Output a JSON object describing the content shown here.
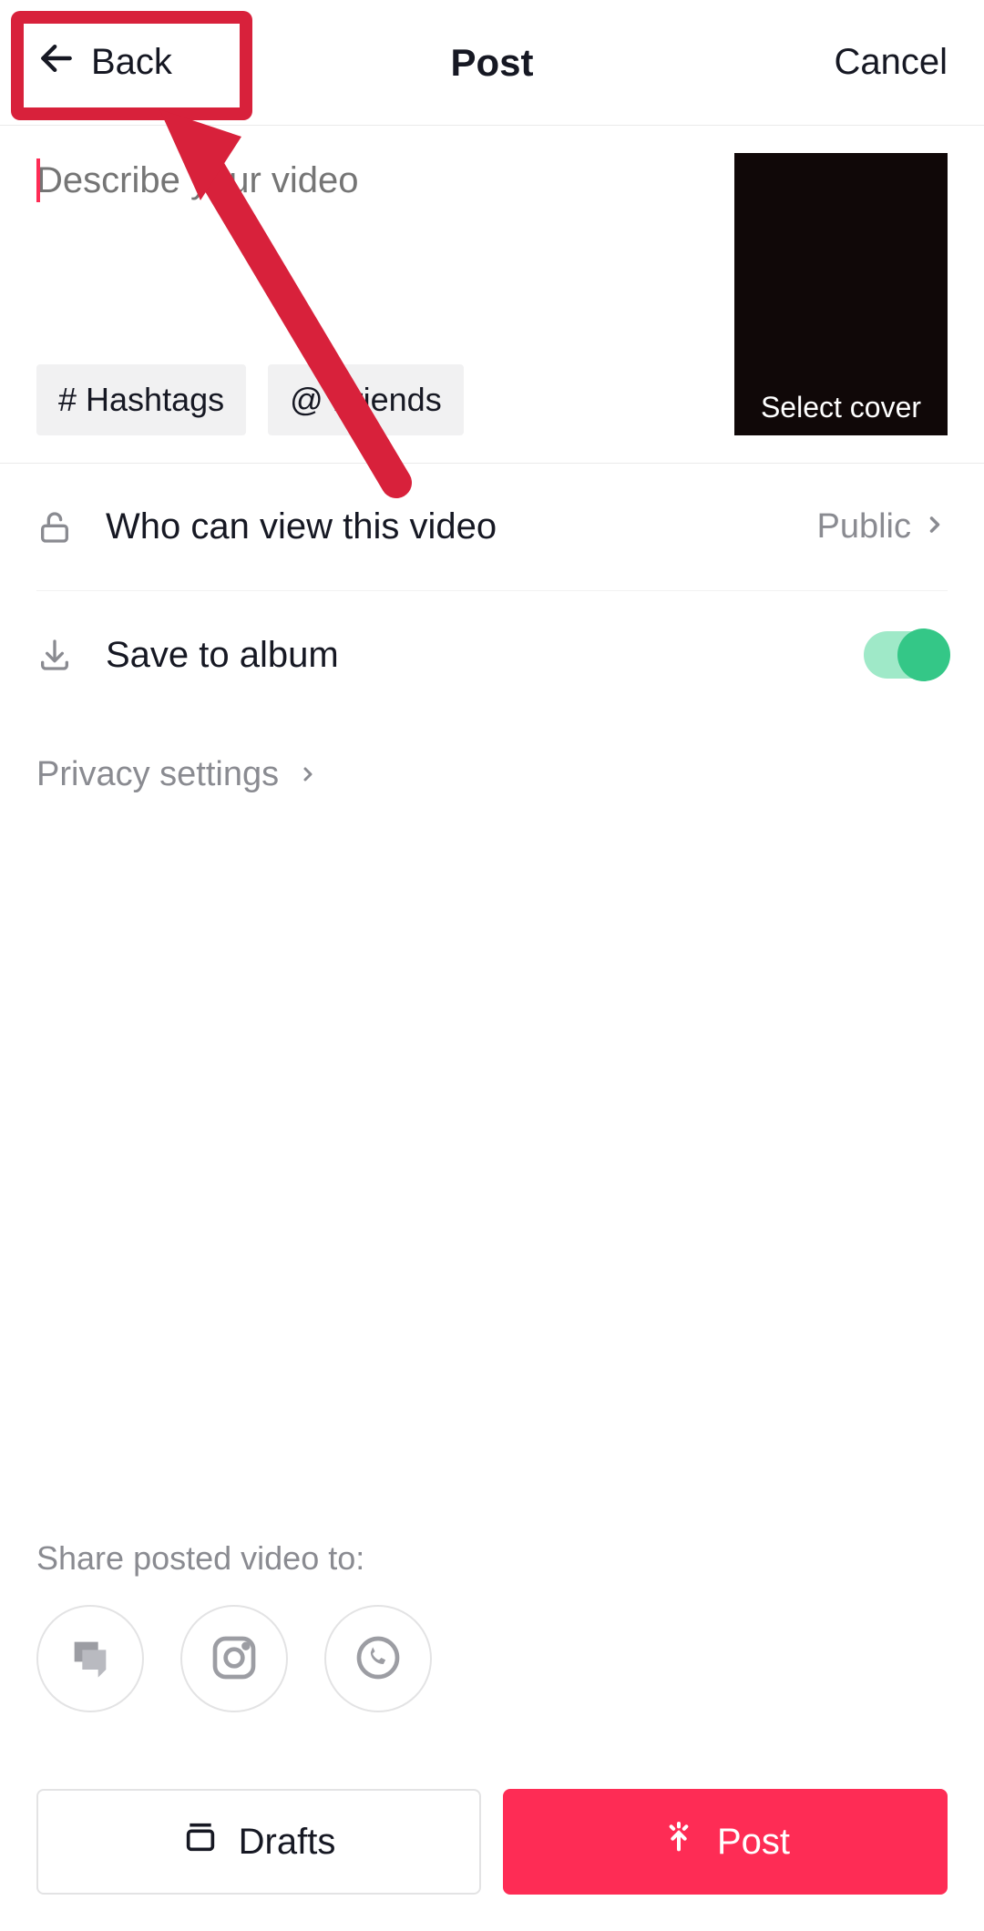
{
  "header": {
    "back_label": "Back",
    "title": "Post",
    "cancel_label": "Cancel"
  },
  "compose": {
    "description_placeholder": "Describe your video",
    "hashtag_chip": "# Hashtags",
    "friends_chip": "@ Friends",
    "cover_label": "Select cover"
  },
  "settings": {
    "who_can_view": {
      "label": "Who can view this video",
      "value": "Public"
    },
    "save_album": {
      "label": "Save to album",
      "enabled": true
    },
    "privacy_link": "Privacy settings"
  },
  "share": {
    "label": "Share posted video to:"
  },
  "footer": {
    "drafts_label": "Drafts",
    "post_label": "Post"
  },
  "colors": {
    "accent": "#fe2c55",
    "toggle_on": "#34c787",
    "highlight": "#d8213b"
  }
}
